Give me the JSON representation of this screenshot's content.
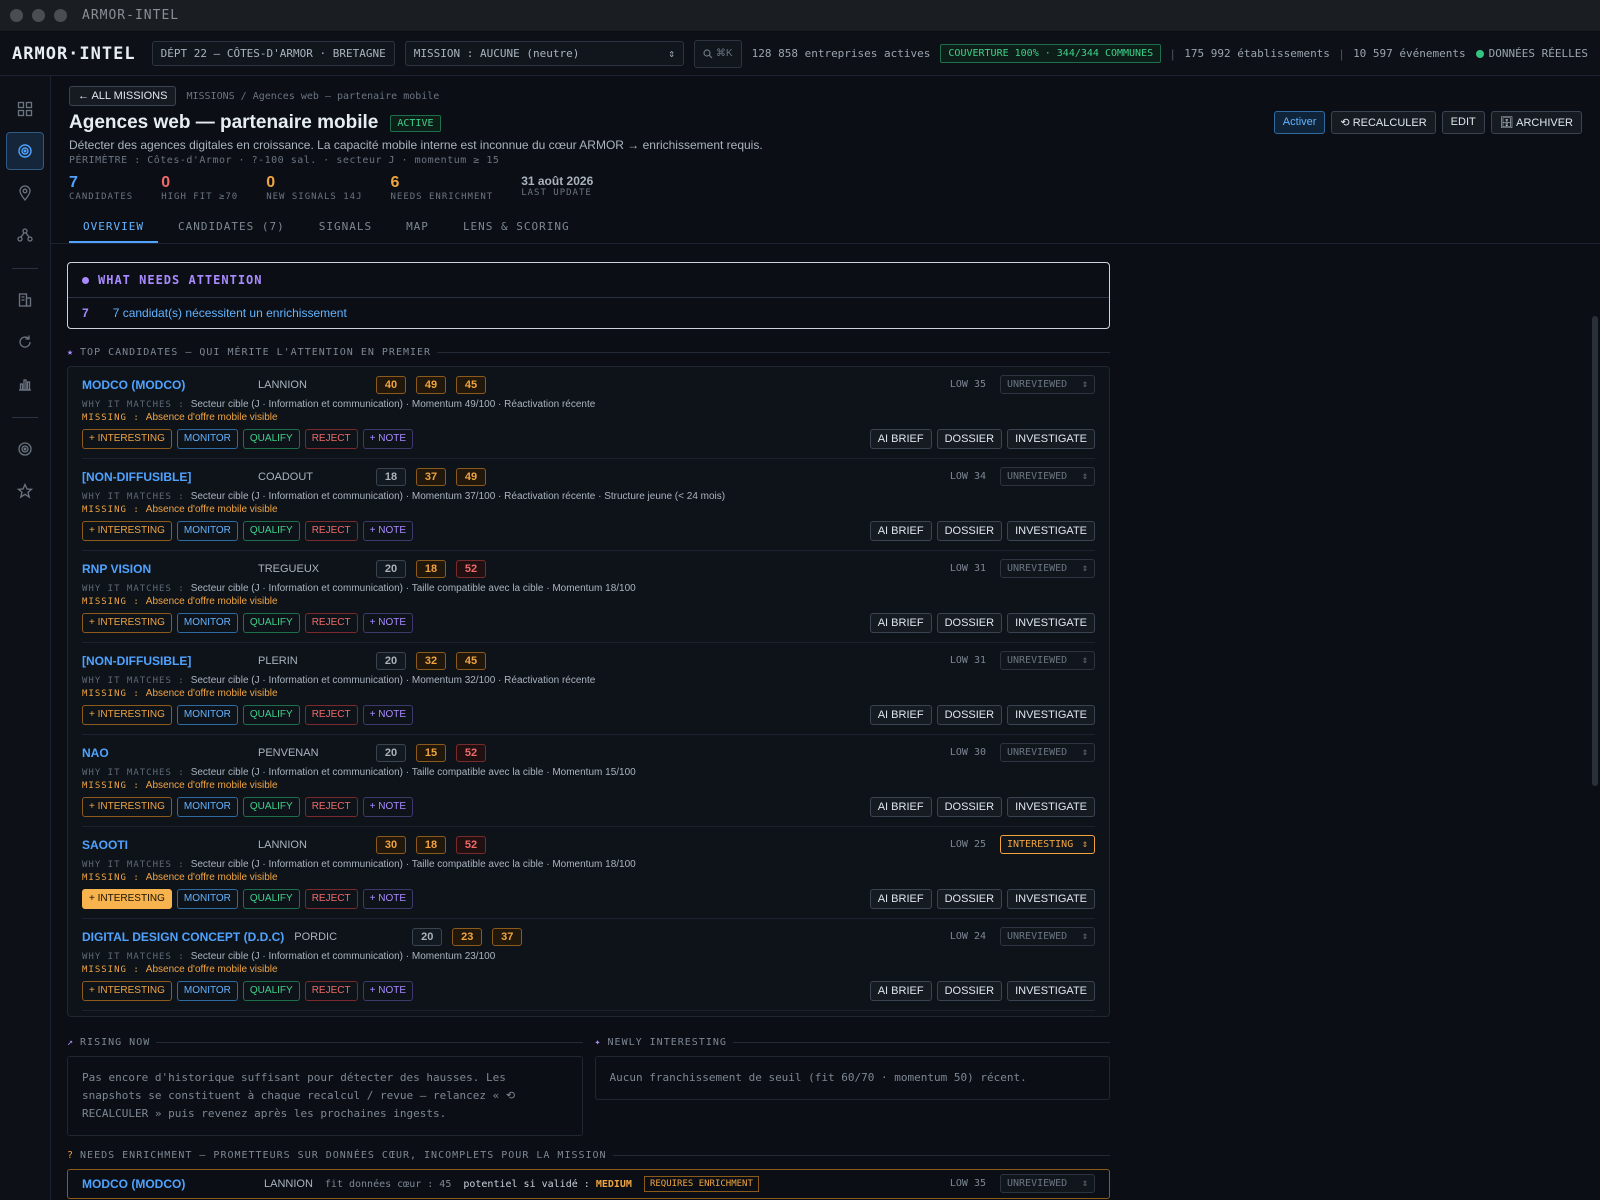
{
  "window": {
    "title": "ARMOR-INTEL"
  },
  "topbar": {
    "logo": "ARMOR·INTEL",
    "dept": "DÉPT 22 — CÔTES-D'ARMOR · BRETAGNE",
    "mission": "MISSION : AUCUNE (neutre)",
    "search_hint": "⌘K",
    "active_companies": "128 858 entreprises actives",
    "coverage": "COUVERTURE 100% · 344/344 COMMUNES",
    "establishments": "175 992 établissements",
    "events": "10 597 événements",
    "live": "DONNÉES RÉELLES"
  },
  "header": {
    "back": "← ALL MISSIONS",
    "breadcrumb": "MISSIONS / Agences web — partenaire mobile",
    "title": "Agences web — partenaire mobile",
    "status": "ACTIVE",
    "description": "Détecter des agences digitales en croissance. La capacité mobile interne est inconnue du cœur ARMOR → enrichissement requis.",
    "perimeter": "PÉRIMÈTRE : Côtes-d'Armor · ?-100 sal. · secteur J · momentum ≥ 15",
    "actions": {
      "activate": "Activer",
      "recalc": "⟲ RECALCULER",
      "edit": "EDIT",
      "archive": "🗄 ARCHIVER"
    },
    "kpis": [
      {
        "value": "7",
        "label": "CANDIDATES",
        "color": "#4fa3ff"
      },
      {
        "value": "0",
        "label": "HIGH FIT ≥70",
        "color": "#f06a6a"
      },
      {
        "value": "0",
        "label": "NEW SIGNALS 14J",
        "color": "#f0a440"
      },
      {
        "value": "6",
        "label": "NEEDS ENRICHMENT",
        "color": "#f0a440"
      }
    ],
    "last_update": {
      "value": "31 août 2026",
      "label": "LAST UPDATE"
    },
    "tabs": [
      "OVERVIEW",
      "CANDIDATES (7)",
      "SIGNALS",
      "MAP",
      "LENS & SCORING"
    ]
  },
  "attention": {
    "title": "WHAT NEEDS ATTENTION",
    "count": "7",
    "text": "7 candidat(s) nécessitent un enrichissement"
  },
  "top": {
    "title": "TOP CANDIDATES — QUI MÉRITE L'ATTENTION EN PREMIER",
    "why_label": "WHY IT MATCHES :",
    "missing_label": "MISSING :",
    "tags": [
      "+ INTERESTING",
      "MONITOR",
      "QUALIFY",
      "REJECT",
      "+ NOTE"
    ],
    "buttons": [
      "AI BRIEF",
      "DOSSIER",
      "INVESTIGATE"
    ],
    "candidates": [
      {
        "name": "MODCO (MODCO)",
        "city": "LANNION",
        "scores": [
          [
            "40",
            "orange"
          ],
          [
            "49",
            "orange"
          ],
          [
            "45",
            "orange"
          ]
        ],
        "low": "LOW 35",
        "status": "UNREVIEWED",
        "why": "Secteur cible (J · Information et communication) · Momentum 49/100 · Réactivation récente",
        "missing": "Absence d'offre mobile visible"
      },
      {
        "name": "[NON-DIFFUSIBLE]",
        "city": "COADOUT",
        "scores": [
          [
            "18",
            "grey"
          ],
          [
            "37",
            "orange"
          ],
          [
            "49",
            "orange"
          ]
        ],
        "low": "LOW 34",
        "status": "UNREVIEWED",
        "why": "Secteur cible (J · Information et communication) · Momentum 37/100 · Réactivation récente · Structure jeune (< 24 mois)",
        "missing": "Absence d'offre mobile visible"
      },
      {
        "name": "RNP VISION",
        "city": "TREGUEUX",
        "scores": [
          [
            "20",
            "grey"
          ],
          [
            "18",
            "orange"
          ],
          [
            "52",
            "red"
          ]
        ],
        "low": "LOW 31",
        "status": "UNREVIEWED",
        "why": "Secteur cible (J · Information et communication) · Taille compatible avec la cible · Momentum 18/100",
        "missing": "Absence d'offre mobile visible"
      },
      {
        "name": "[NON-DIFFUSIBLE]",
        "city": "PLERIN",
        "scores": [
          [
            "20",
            "grey"
          ],
          [
            "32",
            "orange"
          ],
          [
            "45",
            "orange"
          ]
        ],
        "low": "LOW 31",
        "status": "UNREVIEWED",
        "why": "Secteur cible (J · Information et communication) · Momentum 32/100 · Réactivation récente",
        "missing": "Absence d'offre mobile visible"
      },
      {
        "name": "NAO",
        "city": "PENVENAN",
        "scores": [
          [
            "20",
            "grey"
          ],
          [
            "15",
            "orange"
          ],
          [
            "52",
            "red"
          ]
        ],
        "low": "LOW 30",
        "status": "UNREVIEWED",
        "why": "Secteur cible (J · Information et communication) · Taille compatible avec la cible · Momentum 15/100",
        "missing": "Absence d'offre mobile visible"
      },
      {
        "name": "SAOOTI",
        "city": "LANNION",
        "scores": [
          [
            "30",
            "orange"
          ],
          [
            "18",
            "orange"
          ],
          [
            "52",
            "red"
          ]
        ],
        "low": "LOW 25",
        "status": "INTERESTING",
        "why": "Secteur cible (J · Information et communication) · Taille compatible avec la cible · Momentum 18/100",
        "missing": "Absence d'offre mobile visible"
      },
      {
        "name": "DIGITAL DESIGN CONCEPT (D.D.C)",
        "city": "PORDIC",
        "scores": [
          [
            "20",
            "grey"
          ],
          [
            "23",
            "orange"
          ],
          [
            "37",
            "orange"
          ]
        ],
        "low": "LOW 24",
        "status": "UNREVIEWED",
        "why": "Secteur cible (J · Information et communication) · Momentum 23/100",
        "missing": "Absence d'offre mobile visible"
      }
    ]
  },
  "rising": {
    "title": "RISING NOW",
    "text": "Pas encore d'historique suffisant pour détecter des hausses. Les snapshots se constituent à chaque recalcul / revue — relancez « ⟲ RECALCULER » puis revenez après les prochaines ingests."
  },
  "newly": {
    "title": "NEWLY INTERESTING",
    "text": "Aucun franchissement de seuil (fit 60/70 · momentum 50) récent."
  },
  "enrichment": {
    "title": "NEEDS ENRICHMENT — PROMETTEURS SUR DONNÉES CŒUR, INCOMPLETS POUR LA MISSION",
    "row": {
      "name": "MODCO (MODCO)",
      "city": "LANNION",
      "fit": "fit données cœur : 45",
      "potential_label": "potentiel si validé :",
      "potential": "MEDIUM",
      "requires": "REQUIRES ENRICHMENT",
      "low": "LOW 35",
      "status": "UNREVIEWED"
    }
  }
}
